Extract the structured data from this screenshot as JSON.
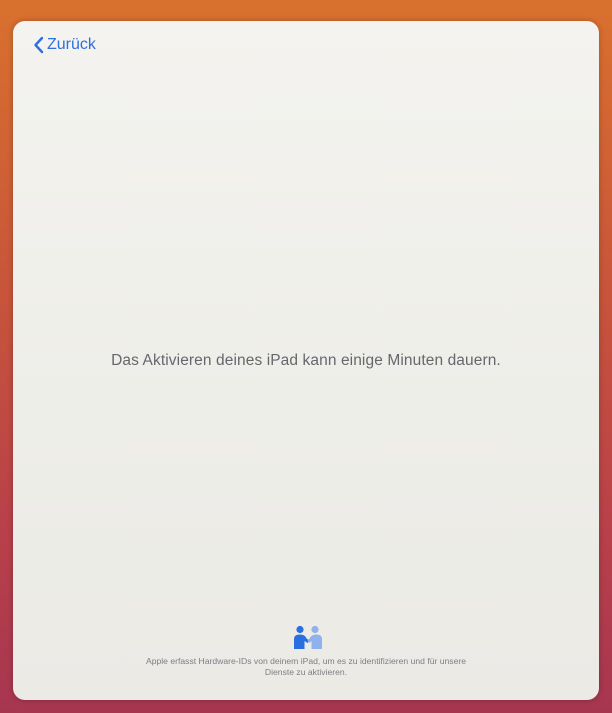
{
  "nav": {
    "back_label": "Zurück"
  },
  "main": {
    "message": "Das Aktivieren deines iPad kann einige Minuten dauern."
  },
  "footer": {
    "icon": "privacy-handshake-icon",
    "line1": "Apple erfasst Hardware-IDs von deinem iPad, um es zu identifizieren und für unsere",
    "line2": "Dienste zu aktivieren."
  },
  "colors": {
    "accent": "#2c6fe0",
    "text": "#66676b",
    "footer_text": "#7d7e84"
  }
}
